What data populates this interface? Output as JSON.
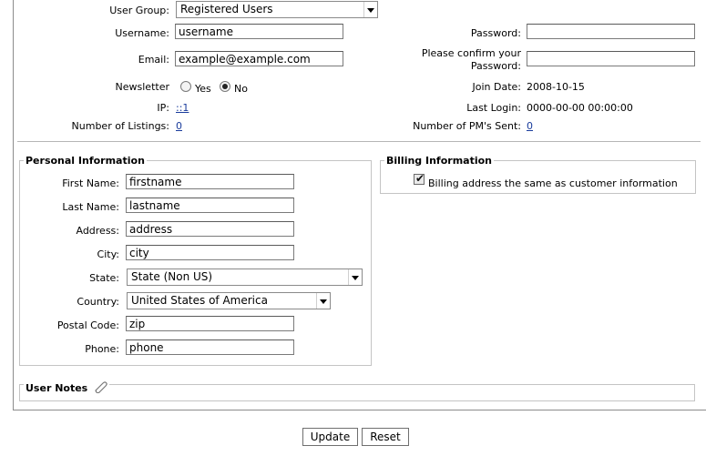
{
  "user_group": {
    "label": "User Group:",
    "value": "Registered Users"
  },
  "username": {
    "label": "Username:",
    "value": "username"
  },
  "email": {
    "label": "Email:",
    "value": "example@example.com"
  },
  "newsletter": {
    "label": "Newsletter",
    "yes": "Yes",
    "no": "No",
    "selected": "No"
  },
  "ip": {
    "label": "IP:",
    "value": "::1"
  },
  "listings": {
    "label": "Number of Listings:",
    "value": "0"
  },
  "password": {
    "label": "Password:",
    "value": ""
  },
  "confirm_password": {
    "label_line1": "Please confirm your",
    "label_line2": "Password:",
    "value": ""
  },
  "join_date": {
    "label": "Join Date:",
    "value": "2008-10-15"
  },
  "last_login": {
    "label": "Last Login:",
    "value": "0000-00-00 00:00:00"
  },
  "pms_sent": {
    "label": "Number of PM's Sent:",
    "value": "0"
  },
  "personal": {
    "legend": "Personal Information",
    "first_name": {
      "label": "First Name:",
      "value": "firstname"
    },
    "last_name": {
      "label": "Last Name:",
      "value": "lastname"
    },
    "address": {
      "label": "Address:",
      "value": "address"
    },
    "city": {
      "label": "City:",
      "value": "city"
    },
    "state": {
      "label": "State:",
      "value": "State (Non US)"
    },
    "country": {
      "label": "Country:",
      "value": "United States of America"
    },
    "postal": {
      "label": "Postal Code:",
      "value": "zip"
    },
    "phone": {
      "label": "Phone:",
      "value": "phone"
    }
  },
  "billing": {
    "legend": "Billing Information",
    "same_label": "Billing address the same as customer information",
    "same_checked": true
  },
  "notes": {
    "legend": "User Notes",
    "icon": "paperclip-icon"
  },
  "buttons": {
    "update": "Update",
    "reset": "Reset"
  }
}
